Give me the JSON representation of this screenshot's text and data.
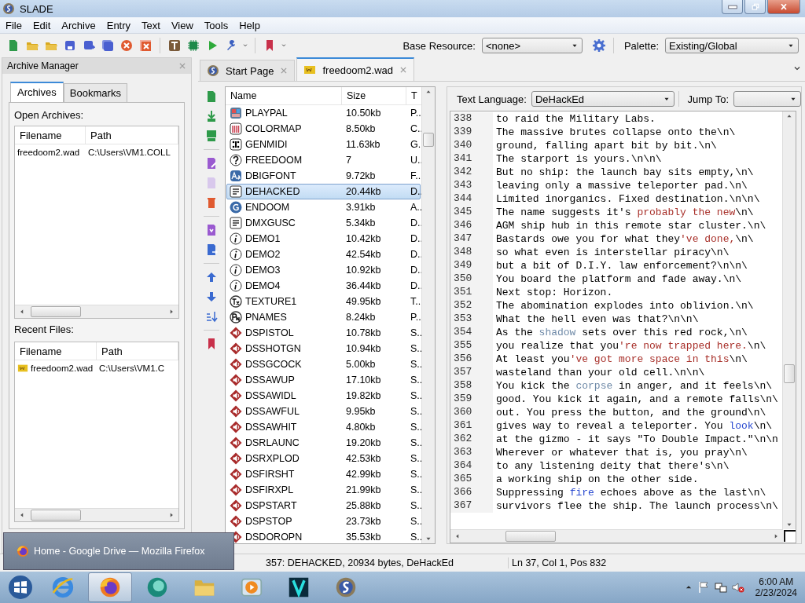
{
  "window": {
    "title": "SLADE"
  },
  "menu": [
    "File",
    "Edit",
    "Archive",
    "Entry",
    "Text",
    "View",
    "Tools",
    "Help"
  ],
  "toolbar": {
    "base_resource": {
      "label": "Base Resource:",
      "value": "<none>"
    },
    "palette": {
      "label": "Palette:",
      "value": "Existing/Global"
    }
  },
  "archive_manager": {
    "title": "Archive Manager",
    "tabs": [
      {
        "label": "Archives",
        "selected": true
      },
      {
        "label": "Bookmarks",
        "selected": false
      }
    ],
    "open_archives": {
      "label": "Open Archives:",
      "columns": [
        "Filename",
        "Path"
      ],
      "rows": [
        {
          "filename": "freedoom2.wad",
          "path": "C:\\Users\\VM1.COLL",
          "icon": false
        }
      ]
    },
    "recent_files": {
      "label": "Recent Files:",
      "columns": [
        "Filename",
        "Path"
      ],
      "rows": [
        {
          "filename": "freedoom2.wad",
          "path": "C:\\Users\\VM1.C",
          "icon": true
        }
      ]
    }
  },
  "document_tabs": [
    {
      "label": "Start Page",
      "kind": "start",
      "selected": false
    },
    {
      "label": "freedoom2.wad",
      "kind": "wad",
      "selected": true
    }
  ],
  "entry_list": {
    "columns": [
      "Name",
      "Size",
      "T"
    ],
    "rows": [
      {
        "name": "PLAYPAL",
        "size": "10.50kb",
        "type": "P..",
        "kind": "palette",
        "selected": false
      },
      {
        "name": "COLORMAP",
        "size": "8.50kb",
        "type": "C..",
        "kind": "colormap",
        "selected": false
      },
      {
        "name": "GENMIDI",
        "size": "11.63kb",
        "type": "G..",
        "kind": "midi",
        "selected": false
      },
      {
        "name": "FREEDOOM",
        "size": "7",
        "type": "U..",
        "kind": "unknown",
        "selected": false
      },
      {
        "name": "DBIGFONT",
        "size": "9.72kb",
        "type": "F..",
        "kind": "font",
        "selected": false
      },
      {
        "name": "DEHACKED",
        "size": "20.44kb",
        "type": "D..",
        "kind": "text",
        "selected": true
      },
      {
        "name": "ENDOOM",
        "size": "3.91kb",
        "type": "A..",
        "kind": "endoom",
        "selected": false
      },
      {
        "name": "DMXGUSC",
        "size": "5.34kb",
        "type": "D..",
        "kind": "text",
        "selected": false
      },
      {
        "name": "DEMO1",
        "size": "10.42kb",
        "type": "D..",
        "kind": "demo",
        "selected": false
      },
      {
        "name": "DEMO2",
        "size": "42.54kb",
        "type": "D..",
        "kind": "demo",
        "selected": false
      },
      {
        "name": "DEMO3",
        "size": "10.92kb",
        "type": "D..",
        "kind": "demo",
        "selected": false
      },
      {
        "name": "DEMO4",
        "size": "36.44kb",
        "type": "D..",
        "kind": "demo",
        "selected": false
      },
      {
        "name": "TEXTURE1",
        "size": "49.95kb",
        "type": "T..",
        "kind": "texture",
        "selected": false
      },
      {
        "name": "PNAMES",
        "size": "8.24kb",
        "type": "P..",
        "kind": "pnames",
        "selected": false
      },
      {
        "name": "DSPISTOL",
        "size": "10.78kb",
        "type": "S..",
        "kind": "sound",
        "selected": false
      },
      {
        "name": "DSSHOTGN",
        "size": "10.94kb",
        "type": "S..",
        "kind": "sound",
        "selected": false
      },
      {
        "name": "DSSGCOCK",
        "size": "5.00kb",
        "type": "S..",
        "kind": "sound",
        "selected": false
      },
      {
        "name": "DSSAWUP",
        "size": "17.10kb",
        "type": "S..",
        "kind": "sound",
        "selected": false
      },
      {
        "name": "DSSAWIDL",
        "size": "19.82kb",
        "type": "S..",
        "kind": "sound",
        "selected": false
      },
      {
        "name": "DSSAWFUL",
        "size": "9.95kb",
        "type": "S..",
        "kind": "sound",
        "selected": false
      },
      {
        "name": "DSSAWHIT",
        "size": "4.80kb",
        "type": "S..",
        "kind": "sound",
        "selected": false
      },
      {
        "name": "DSRLAUNC",
        "size": "19.20kb",
        "type": "S..",
        "kind": "sound",
        "selected": false
      },
      {
        "name": "DSRXPLOD",
        "size": "42.53kb",
        "type": "S..",
        "kind": "sound",
        "selected": false
      },
      {
        "name": "DSFIRSHT",
        "size": "42.99kb",
        "type": "S..",
        "kind": "sound",
        "selected": false
      },
      {
        "name": "DSFIRXPL",
        "size": "21.99kb",
        "type": "S..",
        "kind": "sound",
        "selected": false
      },
      {
        "name": "DSPSTART",
        "size": "25.88kb",
        "type": "S..",
        "kind": "sound",
        "selected": false
      },
      {
        "name": "DSPSTOP",
        "size": "23.73kb",
        "type": "S..",
        "kind": "sound",
        "selected": false
      },
      {
        "name": "DSDOROPN",
        "size": "35.53kb",
        "type": "S..",
        "kind": "sound",
        "selected": false
      }
    ]
  },
  "text_editor": {
    "language_label": "Text Language:",
    "language": "DeHackEd",
    "jump_label": "Jump To:",
    "lines": [
      {
        "number": "338",
        "segments": [
          {
            "text": "to raid the Military Labs.",
            "kind": "plain"
          }
        ]
      },
      {
        "number": "339",
        "segments": [
          {
            "text": "The massive brutes collapse onto the\\n\\",
            "kind": "plain"
          }
        ]
      },
      {
        "number": "340",
        "segments": [
          {
            "text": "ground, falling apart bit by bit.\\n\\",
            "kind": "plain"
          }
        ]
      },
      {
        "number": "341",
        "segments": [
          {
            "text": "The starport is yours.\\n\\n\\",
            "kind": "plain"
          }
        ]
      },
      {
        "number": "342",
        "segments": [
          {
            "text": "But no ship: the launch bay sits empty,\\n\\",
            "kind": "plain"
          }
        ]
      },
      {
        "number": "343",
        "segments": [
          {
            "text": "leaving only a massive teleporter pad.\\n\\",
            "kind": "plain"
          }
        ]
      },
      {
        "number": "344",
        "segments": [
          {
            "text": "Limited inorganics. Fixed destination.\\n\\n\\",
            "kind": "plain"
          }
        ]
      },
      {
        "number": "345",
        "segments": [
          {
            "text": "The name suggests it's ",
            "kind": "plain"
          },
          {
            "text": "probably the new",
            "kind": "string"
          },
          {
            "text": "\\n\\",
            "kind": "plain"
          }
        ]
      },
      {
        "number": "346",
        "segments": [
          {
            "text": "AGM ship hub in this remote star cluster.\\n\\",
            "kind": "plain"
          }
        ]
      },
      {
        "number": "347",
        "segments": [
          {
            "text": "Bastards owe you for what they",
            "kind": "plain"
          },
          {
            "text": "'ve done,",
            "kind": "string"
          },
          {
            "text": "\\n\\",
            "kind": "plain"
          }
        ]
      },
      {
        "number": "348",
        "segments": [
          {
            "text": "so what even is interstellar piracy\\n\\",
            "kind": "plain"
          }
        ]
      },
      {
        "number": "349",
        "segments": [
          {
            "text": "but a bit of D.I.Y. law enforcement?\\n\\n\\",
            "kind": "plain"
          }
        ]
      },
      {
        "number": "350",
        "segments": [
          {
            "text": "You board the platform and fade away.\\n\\",
            "kind": "plain"
          }
        ]
      },
      {
        "number": "351",
        "segments": [
          {
            "text": "Next stop: Horizon.",
            "kind": "plain"
          }
        ]
      },
      {
        "number": "352",
        "segments": [
          {
            "text": "The abomination explodes into oblivion.\\n\\",
            "kind": "plain"
          }
        ]
      },
      {
        "number": "353",
        "segments": [
          {
            "text": "What the hell even was that?\\n\\n\\",
            "kind": "plain"
          }
        ]
      },
      {
        "number": "354",
        "segments": [
          {
            "text": "As the ",
            "kind": "plain"
          },
          {
            "text": "shadow",
            "kind": "property"
          },
          {
            "text": " sets over this red rock,\\n\\",
            "kind": "plain"
          }
        ]
      },
      {
        "number": "355",
        "segments": [
          {
            "text": "you realize that you",
            "kind": "plain"
          },
          {
            "text": "'re now trapped here.",
            "kind": "string"
          },
          {
            "text": "\\n\\",
            "kind": "plain"
          }
        ]
      },
      {
        "number": "356",
        "segments": [
          {
            "text": "At least you",
            "kind": "plain"
          },
          {
            "text": "'ve got more space in this",
            "kind": "string"
          },
          {
            "text": "\\n\\",
            "kind": "plain"
          }
        ]
      },
      {
        "number": "357",
        "segments": [
          {
            "text": "wasteland than your old cell.\\n\\n\\",
            "kind": "plain"
          }
        ]
      },
      {
        "number": "358",
        "segments": [
          {
            "text": "You kick the ",
            "kind": "plain"
          },
          {
            "text": "corpse",
            "kind": "property"
          },
          {
            "text": " in anger, and it feels\\n\\",
            "kind": "plain"
          }
        ]
      },
      {
        "number": "359",
        "segments": [
          {
            "text": "good. You kick it again, and a remote falls\\n\\",
            "kind": "plain"
          }
        ]
      },
      {
        "number": "360",
        "segments": [
          {
            "text": "out. You press the button, and the ground\\n\\",
            "kind": "plain"
          }
        ]
      },
      {
        "number": "361",
        "segments": [
          {
            "text": "gives way to reveal a teleporter. You ",
            "kind": "plain"
          },
          {
            "text": "look",
            "kind": "keyword"
          },
          {
            "text": "\\n\\",
            "kind": "plain"
          }
        ]
      },
      {
        "number": "362",
        "segments": [
          {
            "text": "at the gizmo - it says \"To Double Impact.\"\\n\\n",
            "kind": "plain"
          }
        ]
      },
      {
        "number": "363",
        "segments": [
          {
            "text": "Wherever or whatever that is, you pray\\n\\",
            "kind": "plain"
          }
        ]
      },
      {
        "number": "364",
        "segments": [
          {
            "text": "to any listening deity that there's\\n\\",
            "kind": "plain"
          }
        ]
      },
      {
        "number": "365",
        "segments": [
          {
            "text": "a working ship on the other side.",
            "kind": "plain"
          }
        ]
      },
      {
        "number": "366",
        "segments": [
          {
            "text": "Suppressing ",
            "kind": "plain"
          },
          {
            "text": "fire",
            "kind": "keyword"
          },
          {
            "text": " echoes above as the last\\n\\",
            "kind": "plain"
          }
        ]
      },
      {
        "number": "367",
        "segments": [
          {
            "text": "survivors flee the ship. The launch process\\n\\",
            "kind": "plain"
          }
        ]
      }
    ]
  },
  "status_bar": [
    "357: DEHACKED, 20934 bytes, DeHackEd",
    "Ln 37, Col 1, Pos 832"
  ],
  "taskbar": {
    "popup": "Home - Google Drive — Mozilla Firefox",
    "apps": [
      {
        "kind": "browser-e",
        "selected": false
      },
      {
        "kind": "firefox",
        "selected": true
      },
      {
        "kind": "chat",
        "selected": false
      },
      {
        "kind": "folder",
        "selected": false
      },
      {
        "kind": "media",
        "selected": false
      },
      {
        "kind": "v-app",
        "selected": false
      },
      {
        "kind": "slade",
        "selected": false
      }
    ],
    "time": "6:00 AM",
    "date": "2/23/2024"
  }
}
